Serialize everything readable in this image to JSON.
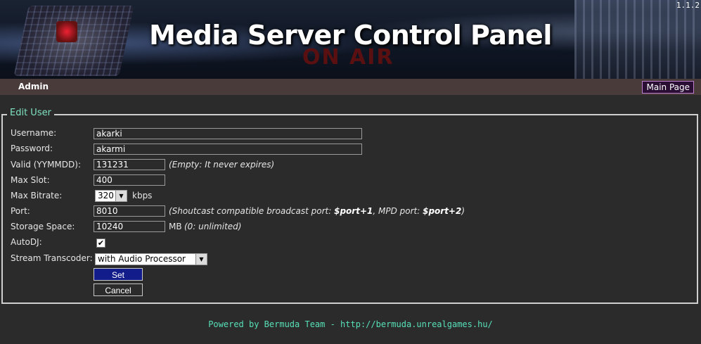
{
  "header": {
    "title": "Media Server Control Panel",
    "version": "1.1.2",
    "background_text": "ON AIR"
  },
  "navbar": {
    "admin_label": "Admin",
    "main_page_button": "Main Page"
  },
  "form": {
    "legend": "Edit User",
    "username": {
      "label": "Username:",
      "value": "akarki"
    },
    "password": {
      "label": "Password:",
      "value": "akarmi"
    },
    "valid": {
      "label": "Valid (YYMMDD):",
      "value": "131231",
      "note": "(Empty: It never expires)"
    },
    "max_slot": {
      "label": "Max Slot:",
      "value": "400"
    },
    "max_bitrate": {
      "label": "Max Bitrate:",
      "selected": "320",
      "unit": "kbps"
    },
    "port": {
      "label": "Port:",
      "value": "8010",
      "note_prefix": "(Shoutcast compatible broadcast port: ",
      "note_sc": "$port+1",
      "note_mid": ", MPD port: ",
      "note_mpd": "$port+2",
      "note_suffix": ")"
    },
    "storage": {
      "label": "Storage Space:",
      "value": "10240",
      "unit": "MB",
      "note": "(0: unlimited)"
    },
    "autodj": {
      "label": "AutoDJ:",
      "checked": true,
      "check_glyph": "✔"
    },
    "transcoder": {
      "label": "Stream Transcoder:",
      "selected": "with Audio Processor"
    },
    "set_button": "Set",
    "cancel_button": "Cancel"
  },
  "footer": {
    "text": "Powered by Bermuda Team - http://bermuda.unrealgames.hu/"
  },
  "colors": {
    "background": "#2b2b2b",
    "navbar": "#4a3b3b",
    "legend": "#7fe3c0",
    "footer": "#57e0b8",
    "set_button": "#121c8a",
    "main_page_button": "#2a0e34"
  }
}
